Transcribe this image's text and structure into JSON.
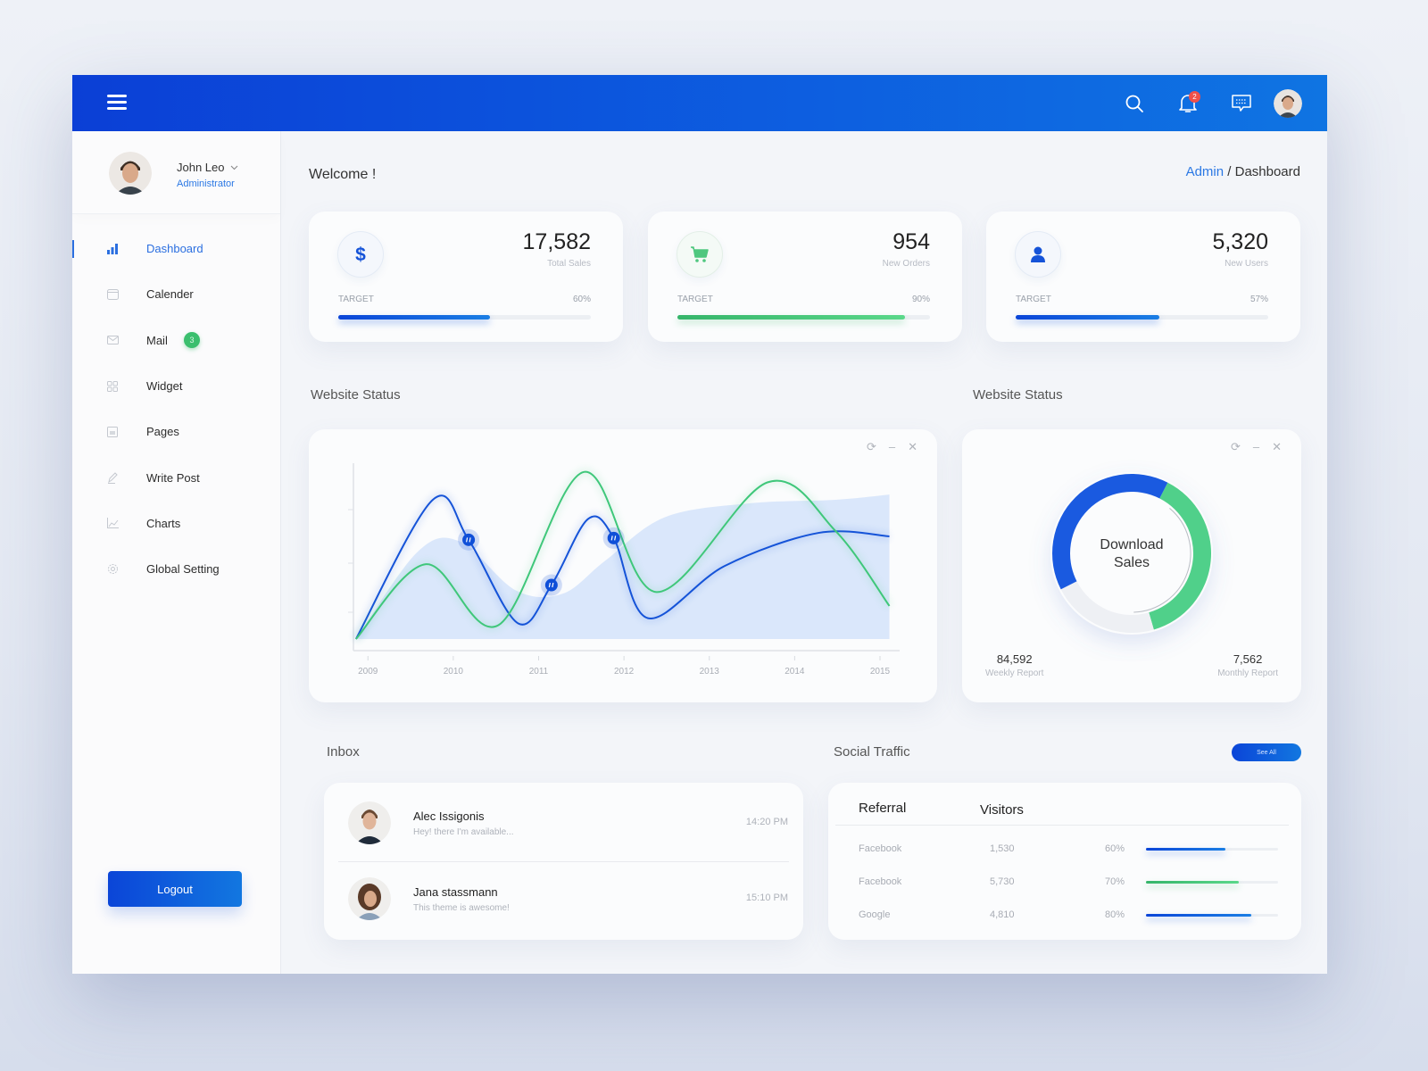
{
  "topbar": {
    "menu_icon": "hamburger-menu-icon",
    "icons": [
      "search-icon",
      "bell-icon",
      "chat-icon"
    ],
    "notification_count": "2"
  },
  "user": {
    "name": "John Leo",
    "role": "Administrator"
  },
  "sidebar": {
    "items": [
      {
        "label": "Dashboard",
        "icon": "bar-chart-icon",
        "active": true
      },
      {
        "label": "Calender",
        "icon": "calendar-icon"
      },
      {
        "label": "Mail",
        "icon": "mail-icon",
        "badge": "3"
      },
      {
        "label": "Widget",
        "icon": "grid-icon"
      },
      {
        "label": "Pages",
        "icon": "pages-icon"
      },
      {
        "label": "Write Post",
        "icon": "pencil-icon"
      },
      {
        "label": "Charts",
        "icon": "line-chart-icon"
      },
      {
        "label": "Global Setting",
        "icon": "gear-icon"
      }
    ],
    "logout_label": "Logout"
  },
  "header": {
    "welcome": "Welcome !",
    "breadcrumb": {
      "root": "Admin",
      "separator": " / ",
      "current": "Dashboard"
    }
  },
  "stats": [
    {
      "value": "17,582",
      "label": "Total Sales",
      "target_label": "TARGET",
      "percent_label": "60%",
      "percent": 60,
      "icon": "dollar-icon",
      "color": "blue"
    },
    {
      "value": "954",
      "label": "New Orders",
      "target_label": "TARGET",
      "percent_label": "90%",
      "percent": 90,
      "icon": "cart-icon",
      "color": "green"
    },
    {
      "value": "5,320",
      "label": "New Users",
      "target_label": "TARGET",
      "percent_label": "57%",
      "percent": 57,
      "icon": "user-icon",
      "color": "blue"
    }
  ],
  "website_status": {
    "title": "Website Status",
    "controls": [
      "refresh-icon",
      "minimize-icon",
      "close-icon"
    ]
  },
  "download_sales": {
    "title": "Website Status",
    "center_line1": "Download",
    "center_line2": "Sales",
    "weekly_value": "84,592",
    "weekly_label": "Weekly Report",
    "monthly_value": "7,562",
    "monthly_label": "Monthly Report"
  },
  "inbox": {
    "title": "Inbox",
    "messages": [
      {
        "name": "Alec Issigonis",
        "text": "Hey! there I'm available...",
        "time": "14:20 PM"
      },
      {
        "name": "Jana stassmann",
        "text": "This theme is awesome!",
        "time": "15:10 PM"
      }
    ]
  },
  "social": {
    "title": "Social Traffic",
    "see_all": "See All",
    "headers": [
      "Referral",
      "Visitors"
    ],
    "rows": [
      {
        "referral": "Facebook",
        "visitors": "1,530",
        "percent_label": "60%",
        "percent": 60,
        "color": "blue"
      },
      {
        "referral": "Facebook",
        "visitors": "5,730",
        "percent_label": "70%",
        "percent": 70,
        "color": "green"
      },
      {
        "referral": "Google",
        "visitors": "4,810",
        "percent_label": "80%",
        "percent": 80,
        "color": "blue"
      }
    ]
  },
  "colors": {
    "primary": "#0b45d8",
    "primary_light": "#1a7ee4",
    "green": "#3fc77a",
    "area": "#d4e3fa",
    "badge_red": "#f0504a"
  },
  "chart_data": [
    {
      "type": "line",
      "title": "Website Status",
      "xlabel": "",
      "ylabel": "",
      "x_ticks": [
        "2009",
        "2010",
        "2011",
        "2012",
        "2013",
        "2014",
        "2015"
      ],
      "xlim": [
        2008.85,
        2015.25
      ],
      "ylim": [
        0,
        100
      ],
      "grid": false,
      "series": [
        {
          "name": "area",
          "kind": "area",
          "color": "#d4e3fa",
          "x": [
            2008.88,
            2009.6,
            2010.1,
            2010.75,
            2011.3,
            2011.8,
            2012.5,
            2013.5,
            2014.5,
            2015.13
          ],
          "y": [
            0,
            50,
            56,
            28,
            26,
            45,
            70,
            78,
            80,
            83
          ]
        },
        {
          "name": "blue",
          "kind": "line",
          "color": "#1553d8",
          "x": [
            2008.88,
            2009.78,
            2010.2,
            2010.78,
            2011.17,
            2011.6,
            2011.9,
            2012.3,
            2013.2,
            2014.3,
            2015.13
          ],
          "y": [
            0,
            80,
            57,
            9,
            31,
            69,
            58,
            12,
            42,
            61,
            59
          ]
        },
        {
          "name": "green",
          "kind": "line",
          "color": "#3fc77a",
          "x": [
            2008.88,
            2009.7,
            2010.55,
            2011.55,
            2012.4,
            2013.7,
            2014.5,
            2015.13
          ],
          "y": [
            0,
            43,
            8,
            96,
            27,
            90,
            62,
            19
          ]
        }
      ],
      "markers": [
        {
          "x": 2010.2,
          "y": 57
        },
        {
          "x": 2011.17,
          "y": 31
        },
        {
          "x": 2011.9,
          "y": 58
        }
      ]
    },
    {
      "type": "pie",
      "title": "Download Sales",
      "variant": "donut",
      "segments": [
        {
          "name": "blue",
          "value": 40,
          "color": "#1a5ae0"
        },
        {
          "name": "green",
          "value": 38,
          "color": "#50d08a"
        },
        {
          "name": "remaining",
          "value": 22,
          "color": "#eef0f4"
        }
      ]
    }
  ]
}
